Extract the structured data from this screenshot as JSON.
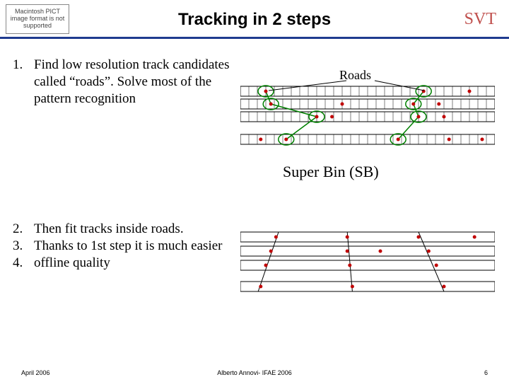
{
  "pict_text": "Macintosh PICT image format is not supported",
  "title": "Tracking in 2 steps",
  "brand": "SVT",
  "items": {
    "n1": "1.",
    "t1": "Find low resolution track candidates called “roads”. Solve most of the pattern recognition",
    "n2": "2.",
    "t2": "Then fit tracks inside roads.",
    "n3": "3.",
    "t3": "Thanks to 1st step it is much easier",
    "n4": "4.",
    "t4": "offline quality"
  },
  "labels": {
    "roads": "Roads",
    "sb": "Super Bin  (SB)"
  },
  "footer": {
    "left": "April 2006",
    "center": "Alberto Annovi- IFAE 2006",
    "right": "6"
  },
  "colors": {
    "rule": "#1f3b8f",
    "svt": "#c0504d",
    "dot": "#c00000",
    "ring": "#008000",
    "grid": "#000000",
    "road_fill": "#ffffff"
  },
  "chart_data": [
    {
      "type": "table",
      "title": "Roads diagram (4 detector layers × super-bins)",
      "layers": 4,
      "bins_per_layer": 30,
      "roads_label": "Roads",
      "hits": [
        {
          "layer": 0,
          "x": 0.1
        },
        {
          "layer": 0,
          "x": 0.72
        },
        {
          "layer": 0,
          "x": 0.9
        },
        {
          "layer": 1,
          "x": 0.12
        },
        {
          "layer": 1,
          "x": 0.4
        },
        {
          "layer": 1,
          "x": 0.68
        },
        {
          "layer": 1,
          "x": 0.78
        },
        {
          "layer": 2,
          "x": 0.3
        },
        {
          "layer": 2,
          "x": 0.36
        },
        {
          "layer": 2,
          "x": 0.7
        },
        {
          "layer": 2,
          "x": 0.8
        },
        {
          "layer": 3,
          "x": 0.08
        },
        {
          "layer": 3,
          "x": 0.18
        },
        {
          "layer": 3,
          "x": 0.62
        },
        {
          "layer": 3,
          "x": 0.82
        },
        {
          "layer": 3,
          "x": 0.95
        }
      ],
      "road_paths": [
        [
          0.1,
          0.12,
          0.3,
          0.18
        ],
        [
          0.72,
          0.68,
          0.7,
          0.62
        ]
      ]
    },
    {
      "type": "table",
      "title": "Fit tracks inside roads (continuous layers)",
      "layers": 4,
      "hits": [
        {
          "layer": 0,
          "x": 0.14
        },
        {
          "layer": 0,
          "x": 0.42
        },
        {
          "layer": 0,
          "x": 0.7
        },
        {
          "layer": 0,
          "x": 0.92
        },
        {
          "layer": 1,
          "x": 0.12
        },
        {
          "layer": 1,
          "x": 0.42
        },
        {
          "layer": 1,
          "x": 0.55
        },
        {
          "layer": 1,
          "x": 0.74
        },
        {
          "layer": 2,
          "x": 0.1
        },
        {
          "layer": 2,
          "x": 0.43
        },
        {
          "layer": 2,
          "x": 0.77
        },
        {
          "layer": 3,
          "x": 0.08
        },
        {
          "layer": 3,
          "x": 0.44
        },
        {
          "layer": 3,
          "x": 0.8
        }
      ],
      "track_lines": [
        {
          "x_top": 0.15,
          "x_bot": 0.07
        },
        {
          "x_top": 0.42,
          "x_bot": 0.44
        },
        {
          "x_top": 0.7,
          "x_bot": 0.8
        }
      ]
    }
  ]
}
